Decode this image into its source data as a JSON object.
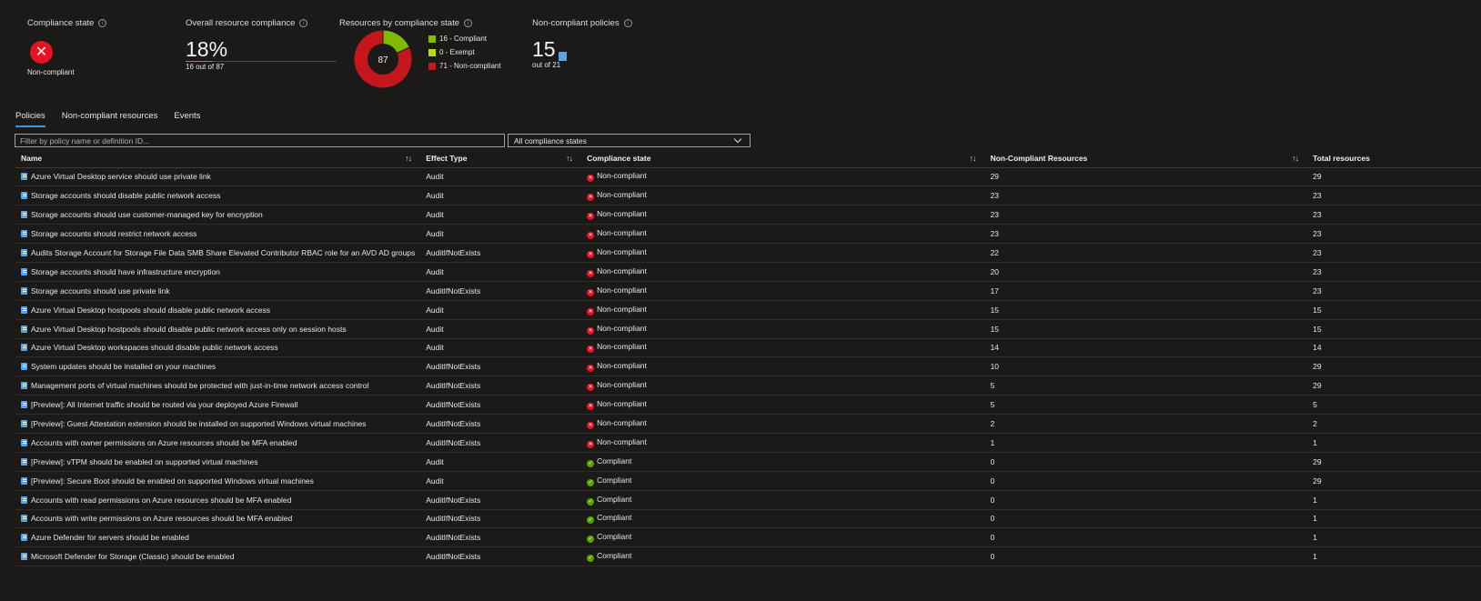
{
  "kpis": {
    "compliance_state": {
      "label": "Compliance state",
      "value": "Non-compliant"
    },
    "overall": {
      "label": "Overall resource compliance",
      "percent": "18%",
      "sub": "16 out of 87",
      "fraction": 0.18
    },
    "by_state": {
      "label": "Resources by compliance state",
      "total": "87",
      "legend": [
        {
          "label": "16 - Compliant",
          "count": 16,
          "color": "#7fba00"
        },
        {
          "label": "0 - Exempt",
          "count": 0,
          "color": "#bad80a"
        },
        {
          "label": "71 - Non-compliant",
          "count": 71,
          "color": "#c4161c"
        }
      ]
    },
    "non_compliant_policies": {
      "label": "Non-compliant policies",
      "value": "15",
      "sub": "out of 21"
    }
  },
  "tabs": [
    {
      "label": "Policies",
      "active": true
    },
    {
      "label": "Non-compliant resources",
      "active": false
    },
    {
      "label": "Events",
      "active": false
    }
  ],
  "filter": {
    "placeholder": "Filter by policy name or definition ID..."
  },
  "state_filter": {
    "value": "All compliance states"
  },
  "table": {
    "headers": [
      "Name",
      "Effect Type",
      "Compliance state",
      "Non-Compliant Resources",
      "Total resources"
    ],
    "rows": [
      [
        "Azure Virtual Desktop service should use private link",
        "Audit",
        "Non-compliant",
        "29",
        "29"
      ],
      [
        "Storage accounts should disable public network access",
        "Audit",
        "Non-compliant",
        "23",
        "23"
      ],
      [
        "Storage accounts should use customer-managed key for encryption",
        "Audit",
        "Non-compliant",
        "23",
        "23"
      ],
      [
        "Storage accounts should restrict network access",
        "Audit",
        "Non-compliant",
        "23",
        "23"
      ],
      [
        "Audits Storage Account for Storage File Data SMB Share Elevated Contributor RBAC role for an AVD AD groups",
        "AuditIfNotExists",
        "Non-compliant",
        "22",
        "23"
      ],
      [
        "Storage accounts should have infrastructure encryption",
        "Audit",
        "Non-compliant",
        "20",
        "23"
      ],
      [
        "Storage accounts should use private link",
        "AuditIfNotExists",
        "Non-compliant",
        "17",
        "23"
      ],
      [
        "Azure Virtual Desktop hostpools should disable public network access",
        "Audit",
        "Non-compliant",
        "15",
        "15"
      ],
      [
        "Azure Virtual Desktop hostpools should disable public network access only on session hosts",
        "Audit",
        "Non-compliant",
        "15",
        "15"
      ],
      [
        "Azure Virtual Desktop workspaces should disable public network access",
        "Audit",
        "Non-compliant",
        "14",
        "14"
      ],
      [
        "System updates should be installed on your machines",
        "AuditIfNotExists",
        "Non-compliant",
        "10",
        "29"
      ],
      [
        "Management ports of virtual machines should be protected with just-in-time network access control",
        "AuditIfNotExists",
        "Non-compliant",
        "5",
        "29"
      ],
      [
        "[Preview]: All Internet traffic should be routed via your deployed Azure Firewall",
        "AuditIfNotExists",
        "Non-compliant",
        "5",
        "5"
      ],
      [
        "[Preview]: Guest Attestation extension should be installed on supported Windows virtual machines",
        "AuditIfNotExists",
        "Non-compliant",
        "2",
        "2"
      ],
      [
        "Accounts with owner permissions on Azure resources should be MFA enabled",
        "AuditIfNotExists",
        "Non-compliant",
        "1",
        "1"
      ],
      [
        "[Preview]: vTPM should be enabled on supported virtual machines",
        "Audit",
        "Compliant",
        "0",
        "29"
      ],
      [
        "[Preview]: Secure Boot should be enabled on supported Windows virtual machines",
        "Audit",
        "Compliant",
        "0",
        "29"
      ],
      [
        "Accounts with read permissions on Azure resources should be MFA enabled",
        "AuditIfNotExists",
        "Compliant",
        "0",
        "1"
      ],
      [
        "Accounts with write permissions on Azure resources should be MFA enabled",
        "AuditIfNotExists",
        "Compliant",
        "0",
        "1"
      ],
      [
        "Azure Defender for servers should be enabled",
        "AuditIfNotExists",
        "Compliant",
        "0",
        "1"
      ],
      [
        "Microsoft Defender for Storage (Classic) should be enabled",
        "AuditIfNotExists",
        "Compliant",
        "0",
        "1"
      ]
    ]
  }
}
